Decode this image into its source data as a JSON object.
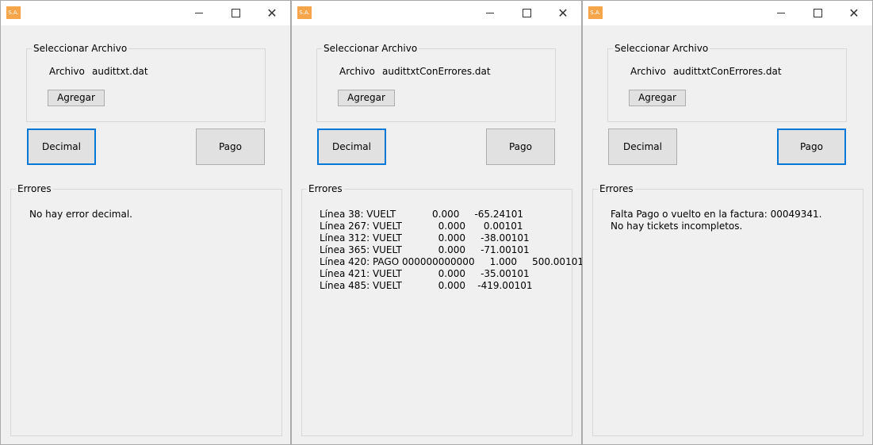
{
  "windows": [
    {
      "app_icon_text": "S.A.",
      "file_group_title": "Seleccionar Archivo",
      "file_label": "Archivo",
      "file_name": "audittxt.dat",
      "add_button": "Agregar",
      "decimal_button": "Decimal",
      "pago_button": "Pago",
      "focused_button": "decimal",
      "errors_group_title": "Errores",
      "error_lines": [
        "No hay error decimal."
      ]
    },
    {
      "app_icon_text": "S.A.",
      "file_group_title": "Seleccionar Archivo",
      "file_label": "Archivo",
      "file_name": "audittxtConErrores.dat",
      "add_button": "Agregar",
      "decimal_button": "Decimal",
      "pago_button": "Pago",
      "focused_button": "decimal",
      "errors_group_title": "Errores",
      "error_lines": [
        "Línea 38: VUELT            0.000     -65.24101",
        "Línea 267: VUELT            0.000      0.00101",
        "Línea 312: VUELT            0.000     -38.00101",
        "Línea 365: VUELT            0.000     -71.00101",
        "Línea 420: PAGO 000000000000     1.000     500.00101",
        "Línea 421: VUELT            0.000     -35.00101",
        "Línea 485: VUELT            0.000    -419.00101"
      ]
    },
    {
      "app_icon_text": "S.A.",
      "file_group_title": "Seleccionar Archivo",
      "file_label": "Archivo",
      "file_name": "audittxtConErrores.dat",
      "add_button": "Agregar",
      "decimal_button": "Decimal",
      "pago_button": "Pago",
      "focused_button": "pago",
      "errors_group_title": "Errores",
      "error_lines": [
        "Falta Pago o vuelto en la factura: 00049341.",
        "No hay tickets incompletos."
      ]
    }
  ],
  "icons": {
    "minimize": "minimize-icon",
    "maximize": "maximize-icon",
    "close": "close-icon"
  },
  "colors": {
    "focus_border": "#0078d7",
    "app_icon_bg": "#f7a54a",
    "window_bg": "#f0f0f0"
  }
}
